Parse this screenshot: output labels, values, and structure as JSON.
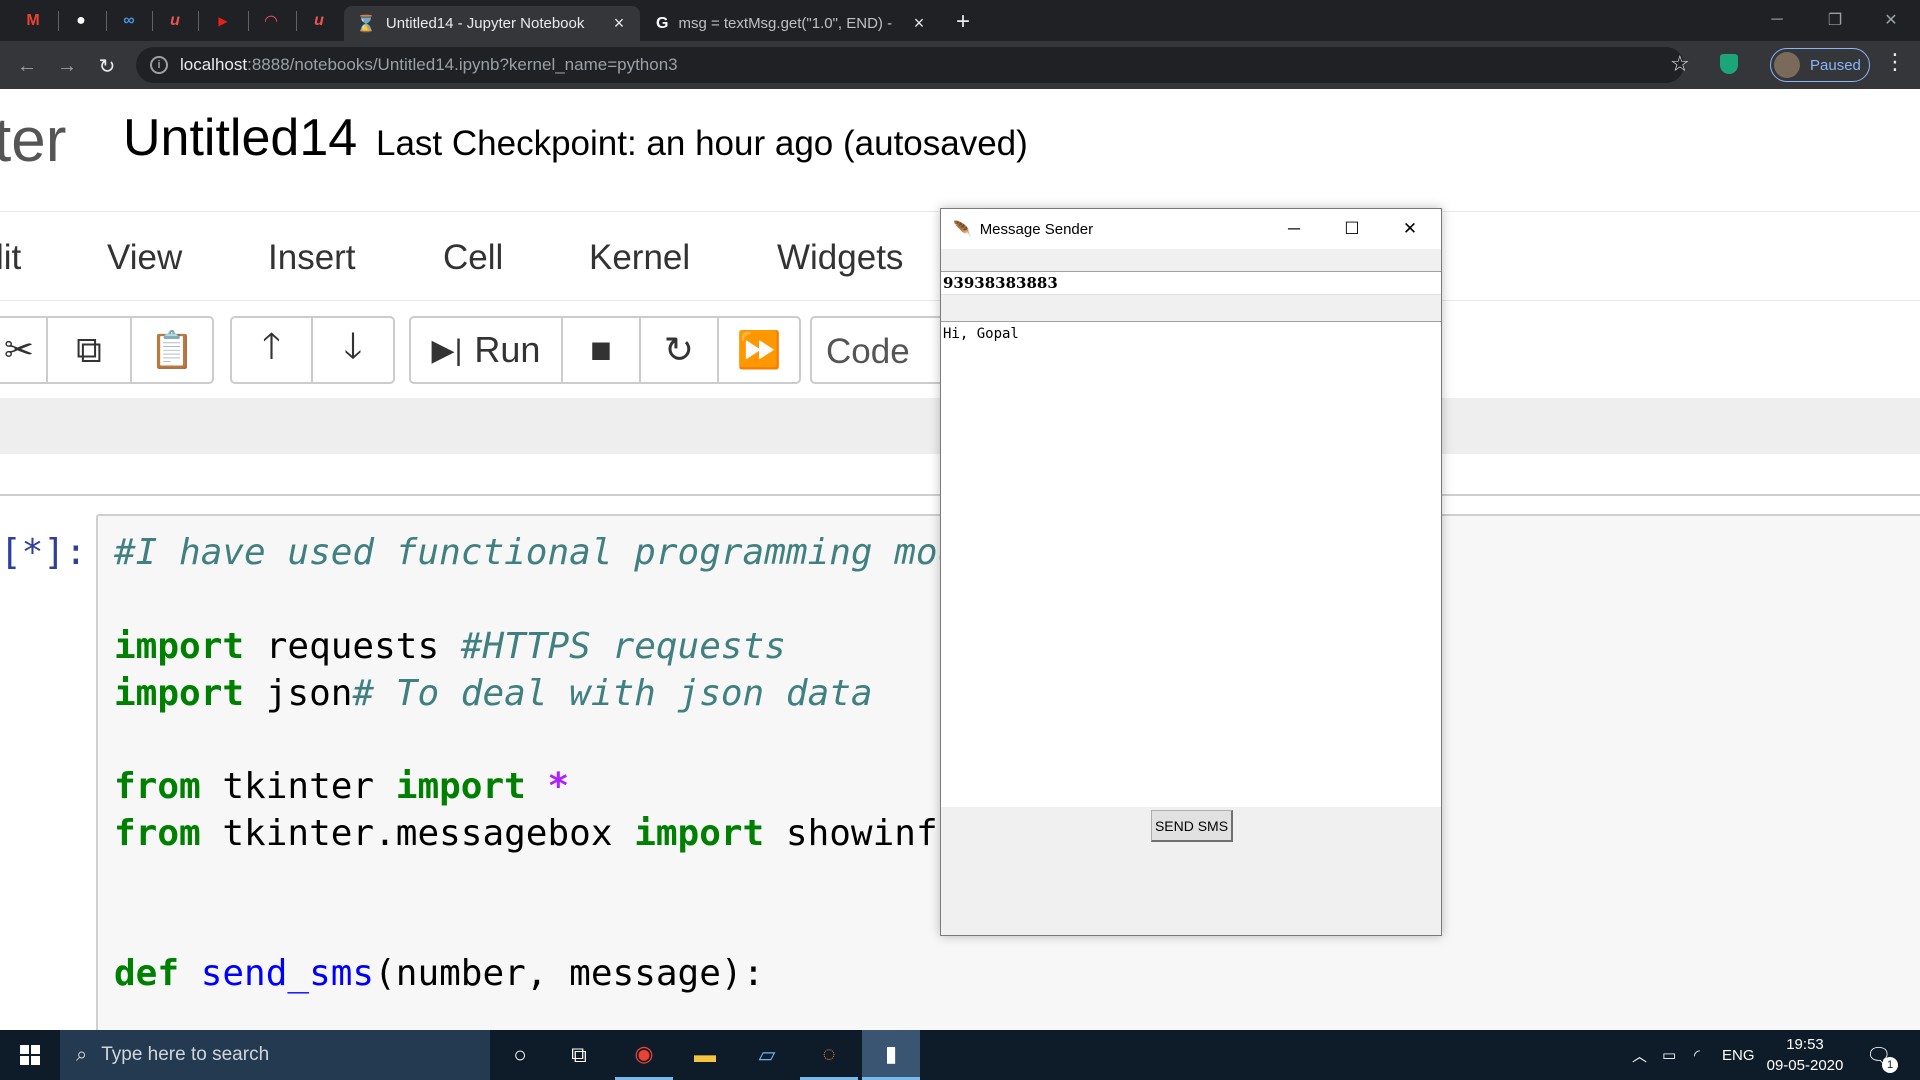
{
  "browser": {
    "tabs": [
      {
        "title": "Untitled14 - Jupyter Notebook",
        "active": true
      },
      {
        "title": "msg = textMsg.get(\"1.0\", END) -",
        "active": false
      }
    ],
    "url_host": "localhost",
    "url_path": ":8888/notebooks/Untitled14.ipynb?kernel_name=python3",
    "profile_label": "Paused"
  },
  "jupyter": {
    "logo_fragment": "ter",
    "notebook_name": "Untitled14",
    "checkpoint": "Last Checkpoint: an hour ago   (autosaved)",
    "menu": [
      "lit",
      "View",
      "Insert",
      "Cell",
      "Kernel",
      "Widgets"
    ],
    "run_label": "Run",
    "cell_type": "Code",
    "prompt": "[*]:",
    "code": {
      "line1": "#I have used functional programming mod",
      "line2_kw": "import",
      "line2_mod": " requests ",
      "line2_cm": "#HTTPS requests",
      "line3_kw": "import",
      "line3_mod": " json",
      "line3_cm": "# To deal with json data",
      "line4_kw1": "from",
      "line4_mod": " tkinter ",
      "line4_kw2": "import",
      "line4_op": " *",
      "line5_kw1": "from",
      "line5_mod": " tkinter.messagebox ",
      "line5_kw2": "import",
      "line5_rest": " showinfo",
      "line6_kw": "def",
      "line6_fn": " send_sms",
      "line6_rest": "(number, message):"
    }
  },
  "tk_window": {
    "title": "Message Sender",
    "number": "93938383883",
    "message": "Hi, Gopal",
    "send_label": "SEND SMS"
  },
  "taskbar": {
    "search_placeholder": "Type here to search",
    "lang": "ENG",
    "time": "19:53",
    "date": "09-05-2020",
    "notification_count": "1"
  },
  "colors": {
    "chrome_dark": "#202124",
    "taskbar": "#0e1c2a",
    "code_keyword": "#008000",
    "code_comment": "#408080"
  }
}
